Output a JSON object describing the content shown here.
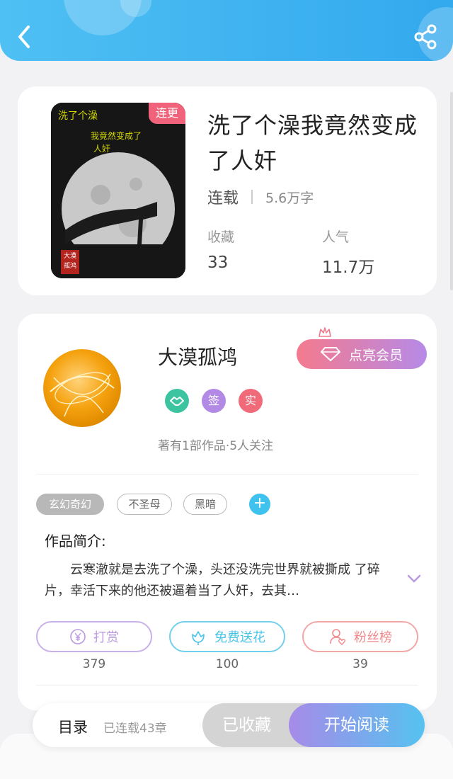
{
  "header": {
    "back_icon": "chevron-left-icon",
    "share_icon": "share-icon"
  },
  "book": {
    "title": "洗了个澡我竟然变成了人奸",
    "badge": "连更",
    "status": "连载",
    "word_count": "5.6万字",
    "favorites_label": "收藏",
    "favorites_value": "33",
    "popularity_label": "人气",
    "popularity_value": "11.7万",
    "cover": {
      "title_line1": "洗了个澡",
      "title_line2": "我竟然变成了",
      "title_line3": "人奸",
      "seal": "大漠孤鸿"
    }
  },
  "author": {
    "name": "大漠孤鸿",
    "vip_label": "点亮会员",
    "badges": [
      {
        "label": "",
        "icon": "handshake-icon",
        "color": "#3cc4a0"
      },
      {
        "label": "签",
        "icon": "",
        "color": "#b28ae6"
      },
      {
        "label": "实",
        "icon": "",
        "color": "#f06a7a"
      }
    ],
    "meta": "著有1部作品·5人关注"
  },
  "tags": [
    "玄幻奇幻",
    "不圣母",
    "黑暗"
  ],
  "intro": {
    "title": "作品简介:",
    "text": "云寒澈就是去洗了个澡，头还没洗完世界就被撕成 了碎片，幸活下来的他还被逼着当了人奸，去其…"
  },
  "actions": [
    {
      "label": "打赏",
      "count": "379",
      "color": "#b99ae0",
      "icon": "yen-icon"
    },
    {
      "label": "免费送花",
      "count": "100",
      "color": "#47c3e8",
      "icon": "flower-icon"
    },
    {
      "label": "粉丝榜",
      "count": "39",
      "color": "#f08a8a",
      "icon": "fan-icon"
    }
  ],
  "bottom": {
    "toc_label": "目录",
    "toc_status": "已连载43章",
    "collected_label": "已收藏",
    "read_label": "开始阅读"
  }
}
